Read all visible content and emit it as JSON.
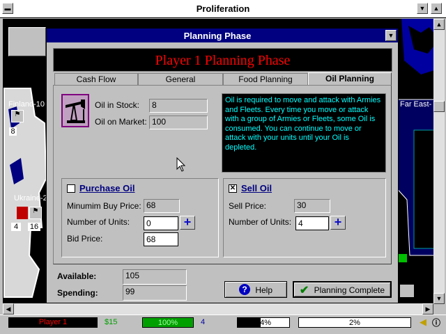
{
  "app": {
    "title": "Proliferation"
  },
  "dialog": {
    "title": "Planning Phase",
    "banner": "Player 1 Planning Phase",
    "tabs": [
      "Cash Flow",
      "General",
      "Food Planning",
      "Oil Planning"
    ],
    "active_tab": "Oil Planning",
    "oil_in_stock_label": "Oil in Stock:",
    "oil_in_stock": "8",
    "oil_on_market_label": "Oil on Market:",
    "oil_on_market": "100",
    "info_text": "Oil is required to move and attack with Armies and Fleets.  Every time you move or attack with a group of   Armies or Fleets, some Oil is consumed.  You can continue to move or attack with your   units until your Oil is depleted.",
    "purchase": {
      "title": "Purchase Oil",
      "checked": false,
      "min_buy_label": "Minumim Buy Price:",
      "min_buy": "68",
      "units_label": "Number of Units:",
      "units": "0",
      "bid_label": "Bid Price:",
      "bid": "68"
    },
    "sell": {
      "title": "Sell Oil",
      "checked": true,
      "check_mark": "✕",
      "price_label": "Sell Price:",
      "price": "30",
      "units_label": "Number of Units:",
      "units": "4"
    },
    "available_label": "Available:",
    "available": "105",
    "spending_label": "Spending:",
    "spending": "99",
    "help_label": "Help",
    "complete_label": "Planning Complete"
  },
  "map": {
    "labels": [
      "Finland-10",
      "Ukraine-2",
      "Far East-"
    ],
    "unit_counts": [
      "8",
      "4",
      "16"
    ]
  },
  "status": {
    "player": "Player 1",
    "money": "$15",
    "food": "100%",
    "turn": "4",
    "oil": "44%",
    "percent": "2%"
  },
  "colors": {
    "title_active": "#000080",
    "banner_text": "#ff0000",
    "info_text": "#00ffff",
    "status_green": "#00a000"
  }
}
